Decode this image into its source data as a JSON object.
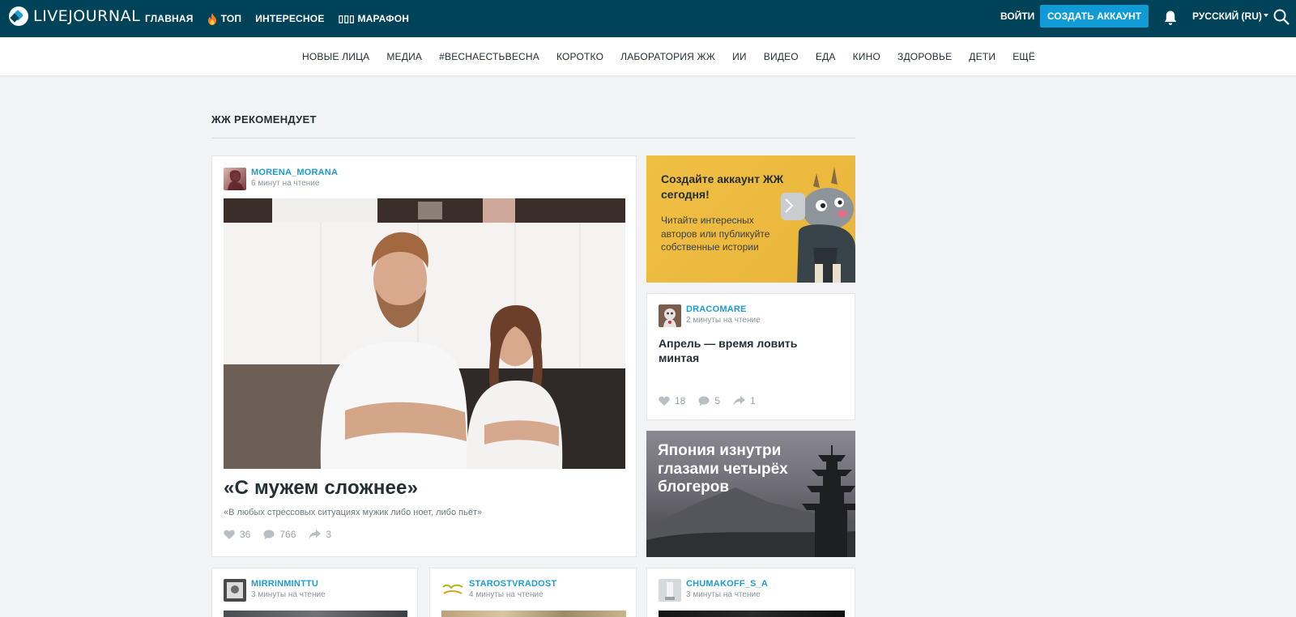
{
  "header": {
    "logo_text": "LIVEJOURNAL",
    "nav": [
      "ГЛАВНАЯ",
      "ТОП",
      "ИНТЕРЕСНОЕ",
      "▯▯▯ МАРАФОН"
    ],
    "login": "ВОЙТИ",
    "create_account": "СОЗДАТЬ АККАУНТ",
    "language": "РУССКИЙ (RU)"
  },
  "subnav": [
    "НОВЫЕ ЛИЦА",
    "МЕДИА",
    "#ВЕСНАЕСТЬВЕСНА",
    "КОРОТКО",
    "ЛАБОРАТОРИЯ ЖЖ",
    "ИИ",
    "ВИДЕО",
    "ЕДА",
    "КИНО",
    "ЗДОРОВЬЕ",
    "ДЕТИ",
    "ЕЩЁ"
  ],
  "section_title": "ЖЖ РЕКОМЕНДУЕТ",
  "featured": {
    "author": "MORENA_MORANA",
    "read_time": "6 минут на чтение",
    "title": "«С мужем сложнее»",
    "subtitle": "«В любых стрессовых ситуациях мужик либо ноет, либо пьёт»",
    "likes": "36",
    "comments": "766",
    "reposts": "3"
  },
  "promo": {
    "title": "Создайте аккаунт ЖЖ сегодня!",
    "text": "Читайте интересных авторов или публикуйте собственные истории"
  },
  "side_post": {
    "author": "DRACOMARE",
    "read_time": "2 минуты на чтение",
    "title": "Апрель — время ловить минтая",
    "likes": "18",
    "comments": "5",
    "reposts": "1"
  },
  "japan": {
    "title": "Япония изнутри глазами четырёх блогеров"
  },
  "bottom_posts": [
    {
      "author": "MIRRINMINTTU",
      "read_time": "3 минуты на чтение"
    },
    {
      "author": "STAROSTVRADOST",
      "read_time": "4 минуты на чтение"
    },
    {
      "author": "CHUMAKOFF_S_A",
      "read_time": "3 минуты на чтение"
    }
  ],
  "colors": {
    "topbar": "#004359",
    "accent": "#119bd5",
    "link": "#1f9bd4"
  }
}
